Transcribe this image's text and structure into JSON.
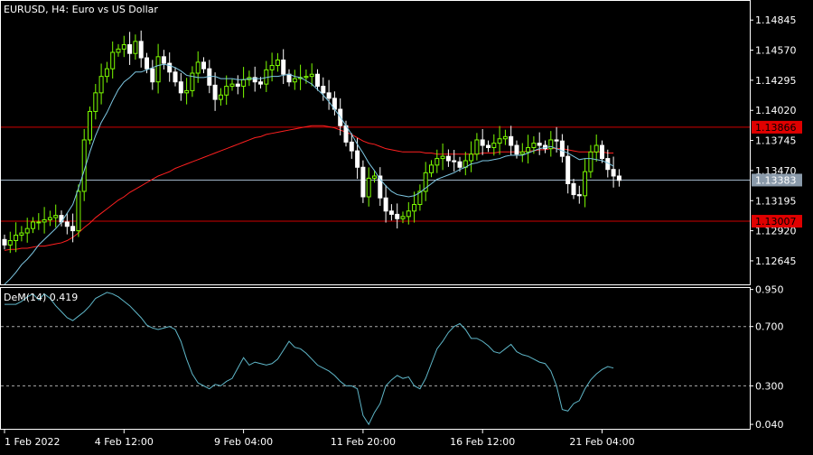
{
  "header": {
    "symbol_line": "EURUSD, H4:  Euro vs US Dollar",
    "indicator_line": "DeM(14) 0.419"
  },
  "colors": {
    "background": "#000000",
    "frame": "#ffffff",
    "bull_candle": "#7CFC00",
    "bear_candle": "#ffffff",
    "ma_fast": "#7ec8e3",
    "ma_slow": "#ff2020",
    "level_line_red": "#d00000",
    "level_line_current": "#a0b4c8",
    "indicator_line": "#5fb7c9",
    "dotted": "#aaaaaa",
    "text": "#ffffff"
  },
  "chart_data": [
    {
      "type": "candlestick",
      "title": "EURUSD, H4:  Euro vs US Dollar",
      "x_ticks": [
        "1 Feb 2022",
        "4 Feb 12:00",
        "9 Feb 04:00",
        "11 Feb 20:00",
        "16 Feb 12:00",
        "21 Feb 04:00"
      ],
      "x_tick_index": [
        0,
        21,
        42,
        63,
        84,
        105
      ],
      "y_ticks": [
        "1.14845",
        "1.14570",
        "1.14295",
        "1.14020",
        "1.13745",
        "1.13470",
        "1.13195",
        "1.12920",
        "1.12645"
      ],
      "ylim": [
        1.1243,
        1.1502
      ],
      "levels": [
        {
          "value": 1.13866,
          "label": "1.13866",
          "style": "red"
        },
        {
          "value": 1.13383,
          "label": "1.13383",
          "style": "current"
        },
        {
          "value": 1.13007,
          "label": "1.13007",
          "style": "red"
        }
      ],
      "close": [
        1.1279,
        1.1283,
        1.1288,
        1.129,
        1.1294,
        1.13,
        1.13,
        1.1302,
        1.1304,
        1.1306,
        1.13,
        1.1296,
        1.1292,
        1.1328,
        1.1375,
        1.1401,
        1.1418,
        1.1433,
        1.144,
        1.1455,
        1.1458,
        1.1462,
        1.1454,
        1.1465,
        1.145,
        1.144,
        1.1428,
        1.1451,
        1.1445,
        1.1437,
        1.1428,
        1.1418,
        1.142,
        1.1436,
        1.1446,
        1.144,
        1.1425,
        1.1412,
        1.1416,
        1.1424,
        1.1426,
        1.1424,
        1.143,
        1.1432,
        1.1428,
        1.1426,
        1.1439,
        1.1443,
        1.1448,
        1.1435,
        1.1428,
        1.1431,
        1.1432,
        1.1433,
        1.1435,
        1.1424,
        1.1418,
        1.1413,
        1.1403,
        1.1388,
        1.1373,
        1.1365,
        1.135,
        1.1323,
        1.134,
        1.1342,
        1.1322,
        1.131,
        1.1307,
        1.1303,
        1.1305,
        1.131,
        1.1316,
        1.1328,
        1.1345,
        1.1352,
        1.1358,
        1.136,
        1.1356,
        1.1355,
        1.135,
        1.1356,
        1.1362,
        1.1375,
        1.137,
        1.1368,
        1.1372,
        1.1376,
        1.1378,
        1.137,
        1.1362,
        1.1364,
        1.1368,
        1.1372,
        1.137,
        1.1367,
        1.1375,
        1.1374,
        1.136,
        1.1335,
        1.1325,
        1.1324,
        1.1346,
        1.1364,
        1.137,
        1.1358,
        1.1348,
        1.1342,
        1.1338
      ],
      "ma_fast": [
        1.1243,
        1.1248,
        1.1254,
        1.1261,
        1.1266,
        1.1272,
        1.1279,
        1.1284,
        1.1289,
        1.1294,
        1.13,
        1.1308,
        1.1316,
        1.1331,
        1.1347,
        1.1364,
        1.1379,
        1.1391,
        1.14,
        1.1411,
        1.1421,
        1.1428,
        1.1432,
        1.1437,
        1.1437,
        1.1439,
        1.1441,
        1.1443,
        1.1444,
        1.1443,
        1.1441,
        1.1438,
        1.1434,
        1.1433,
        1.1432,
        1.1432,
        1.1433,
        1.1433,
        1.1431,
        1.1431,
        1.1431,
        1.143,
        1.143,
        1.1431,
        1.1431,
        1.1431,
        1.1432,
        1.1433,
        1.1433,
        1.1434,
        1.1435,
        1.1433,
        1.1432,
        1.1429,
        1.1426,
        1.1421,
        1.1416,
        1.141,
        1.1403,
        1.1396,
        1.1388,
        1.138,
        1.1371,
        1.1363,
        1.1354,
        1.1347,
        1.1339,
        1.1333,
        1.1328,
        1.1325,
        1.1324,
        1.1323,
        1.1324,
        1.1327,
        1.1331,
        1.1335,
        1.1339,
        1.1341,
        1.1343,
        1.1345,
        1.1348,
        1.135,
        1.1353,
        1.1354,
        1.1356,
        1.1356,
        1.1357,
        1.1358,
        1.136,
        1.1361,
        1.1361,
        1.1361,
        1.1363,
        1.1365,
        1.1367,
        1.1368,
        1.1369,
        1.1367,
        1.1365,
        1.1363,
        1.136,
        1.1357,
        1.1358,
        1.1358,
        1.1357,
        1.1356,
        1.1354,
        1.1351
      ],
      "ma_slow": [
        1.1274,
        1.1275,
        1.1275,
        1.1276,
        1.1276,
        1.1277,
        1.1278,
        1.1278,
        1.1279,
        1.128,
        1.1281,
        1.1283,
        1.1286,
        1.129,
        1.1295,
        1.1299,
        1.1304,
        1.1308,
        1.1312,
        1.1316,
        1.132,
        1.1323,
        1.1327,
        1.133,
        1.1333,
        1.1336,
        1.1339,
        1.1342,
        1.1344,
        1.1346,
        1.1349,
        1.1351,
        1.1353,
        1.1355,
        1.1357,
        1.1359,
        1.1361,
        1.1363,
        1.1365,
        1.1367,
        1.1369,
        1.1371,
        1.1373,
        1.1375,
        1.1377,
        1.1378,
        1.138,
        1.1381,
        1.1382,
        1.1383,
        1.1384,
        1.1385,
        1.1386,
        1.1387,
        1.1388,
        1.1388,
        1.1388,
        1.1387,
        1.1386,
        1.1384,
        1.1382,
        1.138,
        1.1377,
        1.1374,
        1.1372,
        1.1371,
        1.1369,
        1.1367,
        1.1366,
        1.1365,
        1.1364,
        1.1364,
        1.1364,
        1.1364,
        1.1363,
        1.1363,
        1.1362,
        1.1362,
        1.1362,
        1.1362,
        1.1362,
        1.1362,
        1.1362,
        1.1362,
        1.1363,
        1.1363,
        1.1363,
        1.1364,
        1.1364,
        1.1364,
        1.1364,
        1.1364,
        1.1365,
        1.1365,
        1.1366,
        1.1366,
        1.1367,
        1.1367,
        1.1367,
        1.1366,
        1.1365,
        1.1364,
        1.1364,
        1.1364,
        1.1364,
        1.1364,
        1.1363,
        1.1363
      ]
    },
    {
      "type": "line",
      "title": "DeM(14) 0.419",
      "y_ticks": [
        "0.950",
        "0.700",
        "0.300",
        "0.040"
      ],
      "ylim": [
        0.01,
        0.96
      ],
      "levels": [
        0.7,
        0.3
      ],
      "values": [
        0.85,
        0.85,
        0.85,
        0.87,
        0.9,
        0.92,
        0.88,
        0.92,
        0.89,
        0.84,
        0.8,
        0.76,
        0.74,
        0.77,
        0.8,
        0.84,
        0.89,
        0.91,
        0.93,
        0.92,
        0.9,
        0.87,
        0.84,
        0.8,
        0.76,
        0.71,
        0.69,
        0.68,
        0.69,
        0.7,
        0.68,
        0.6,
        0.48,
        0.38,
        0.32,
        0.3,
        0.28,
        0.31,
        0.3,
        0.33,
        0.35,
        0.42,
        0.49,
        0.44,
        0.46,
        0.45,
        0.44,
        0.45,
        0.48,
        0.54,
        0.6,
        0.56,
        0.55,
        0.52,
        0.48,
        0.44,
        0.42,
        0.4,
        0.37,
        0.33,
        0.3,
        0.3,
        0.28,
        0.1,
        0.04,
        0.12,
        0.18,
        0.3,
        0.34,
        0.37,
        0.35,
        0.36,
        0.3,
        0.28,
        0.35,
        0.45,
        0.55,
        0.6,
        0.66,
        0.7,
        0.72,
        0.68,
        0.62,
        0.62,
        0.6,
        0.57,
        0.53,
        0.52,
        0.55,
        0.58,
        0.53,
        0.51,
        0.5,
        0.48,
        0.46,
        0.45,
        0.4,
        0.3,
        0.14,
        0.13,
        0.18,
        0.2,
        0.28,
        0.34,
        0.38,
        0.41,
        0.43,
        0.42
      ]
    }
  ]
}
